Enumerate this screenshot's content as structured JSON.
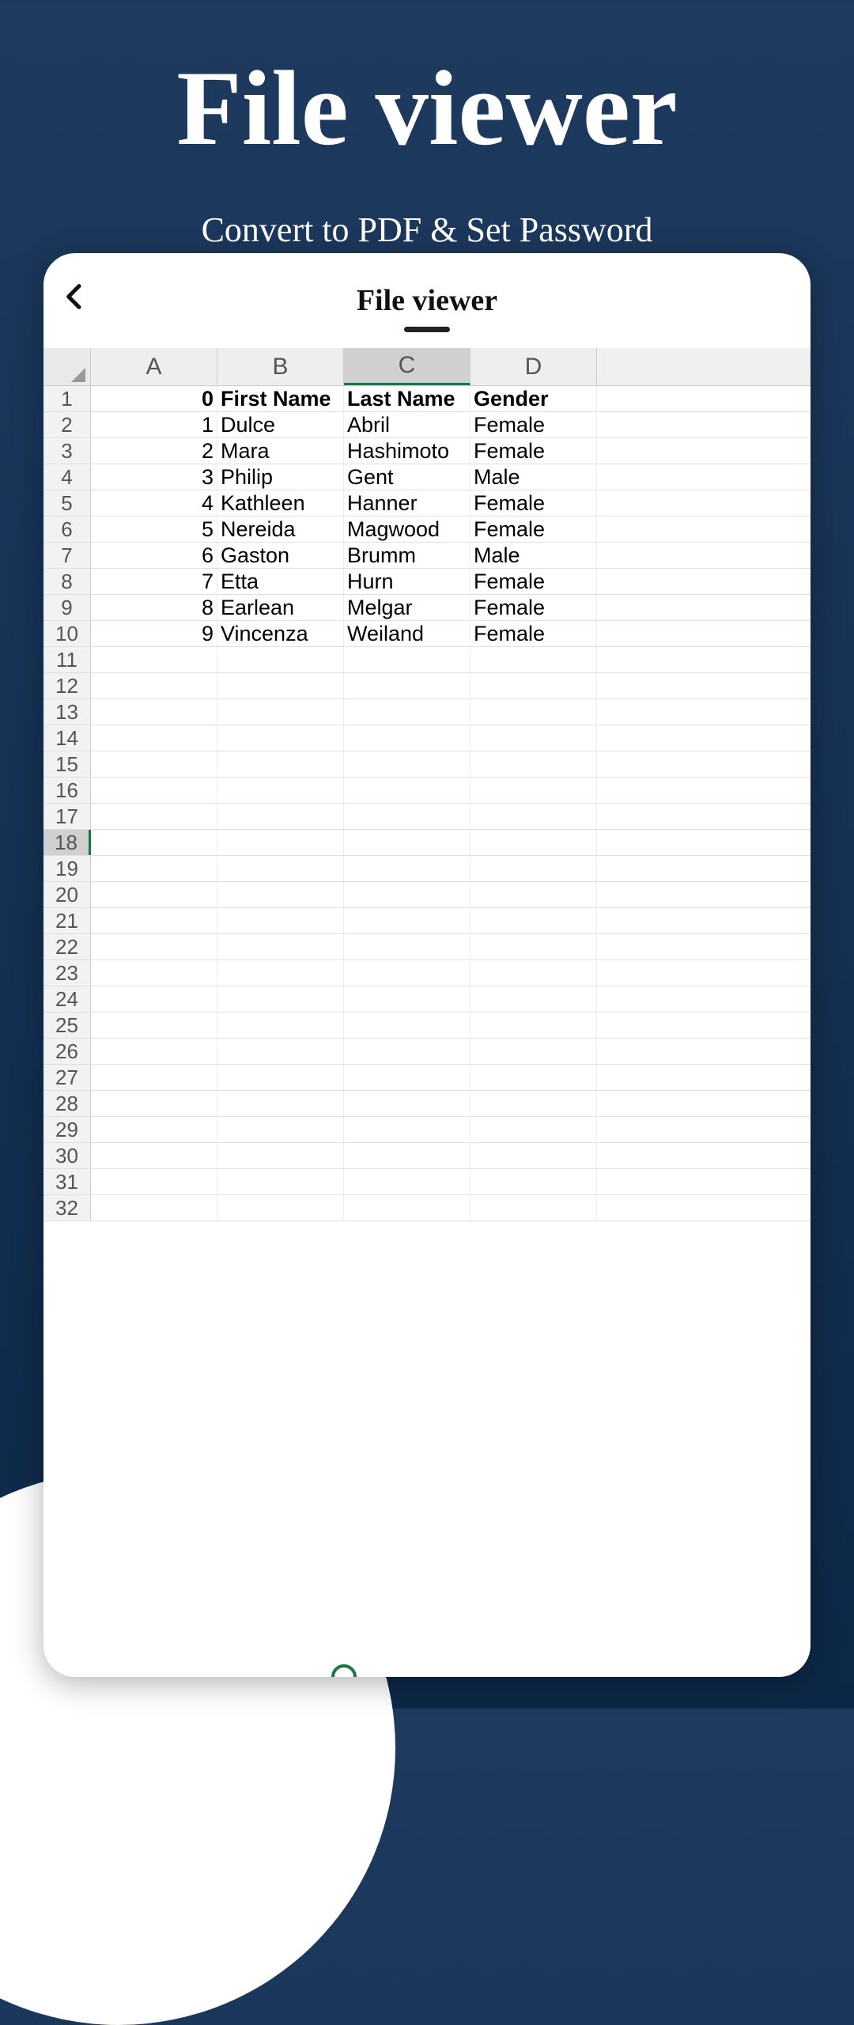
{
  "hero": {
    "title": "File viewer",
    "subtitle": "Convert to PDF & Set Password"
  },
  "app": {
    "title": "File viewer"
  },
  "sheet": {
    "columns": [
      "A",
      "B",
      "C",
      "D"
    ],
    "selected_column_index": 2,
    "selected_row_index": 17,
    "row_count": 32,
    "data": [
      {
        "A": "0",
        "B": "First Name",
        "C": "Last Name",
        "D": "Gender",
        "bold": true
      },
      {
        "A": "1",
        "B": "Dulce",
        "C": "Abril",
        "D": "Female"
      },
      {
        "A": "2",
        "B": "Mara",
        "C": "Hashimoto",
        "D": "Female"
      },
      {
        "A": "3",
        "B": "Philip",
        "C": "Gent",
        "D": "Male"
      },
      {
        "A": "4",
        "B": "Kathleen",
        "C": "Hanner",
        "D": "Female"
      },
      {
        "A": "5",
        "B": "Nereida",
        "C": "Magwood",
        "D": "Female"
      },
      {
        "A": "6",
        "B": "Gaston",
        "C": "Brumm",
        "D": "Male"
      },
      {
        "A": "7",
        "B": "Etta",
        "C": "Hurn",
        "D": "Female"
      },
      {
        "A": "8",
        "B": "Earlean",
        "C": "Melgar",
        "D": "Female"
      },
      {
        "A": "9",
        "B": "Vincenza",
        "C": "Weiland",
        "D": "Female"
      }
    ],
    "selection_handles": {
      "start": {
        "col": "C",
        "row": 17
      },
      "end": {
        "col": "C",
        "row": 18
      }
    }
  }
}
